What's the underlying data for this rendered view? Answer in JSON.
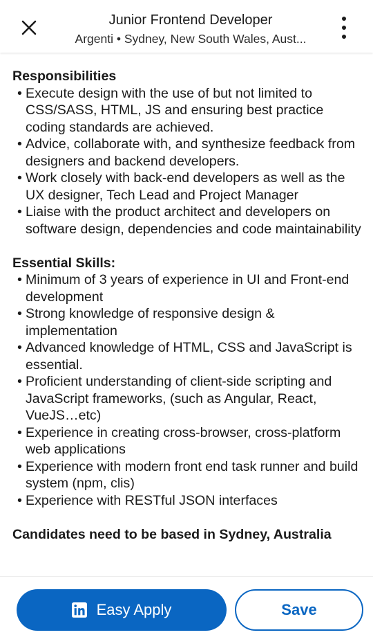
{
  "header": {
    "title": "Junior Frontend Developer",
    "subtitle": "Argenti • Sydney, New South Wales, Aust...",
    "close_icon": "close-icon",
    "more_icon": "more-vertical-icon"
  },
  "description": {
    "responsibilities": {
      "heading": "Responsibilities",
      "items": [
        "Execute design with the use of but not limited to CSS/SASS, HTML, JS and ensuring best practice coding standards are achieved.",
        "Advice, collaborate with, and synthesize feedback from designers and backend developers.",
        "Work closely with back-end developers as well as the UX designer, Tech Lead and Project Manager",
        "Liaise with the product architect and developers on software design, dependencies and code maintainability"
      ]
    },
    "skills": {
      "heading": "Essential Skills:",
      "items": [
        "Minimum of 3 years of experience in UI and Front-end development",
        "Strong knowledge of responsive design & implementation",
        "Advanced knowledge of HTML, CSS and JavaScript is essential.",
        "Proficient understanding of client-side scripting and JavaScript frameworks, (such as Angular, React, VueJS…etc)",
        "Experience in creating cross-browser, cross-platform web applications",
        "Experience with modern front end task runner and build system (npm, clis)",
        "Experience with RESTful JSON interfaces"
      ]
    },
    "closing_note": "Candidates need to be based in Sydney, Australia",
    "bullet_char": "•"
  },
  "footer": {
    "easy_apply_label": "Easy Apply",
    "save_label": "Save",
    "apply_icon": "linkedin-icon"
  },
  "colors": {
    "brand": "#0a66c2",
    "text": "#1b1b1b",
    "background": "#ffffff"
  }
}
